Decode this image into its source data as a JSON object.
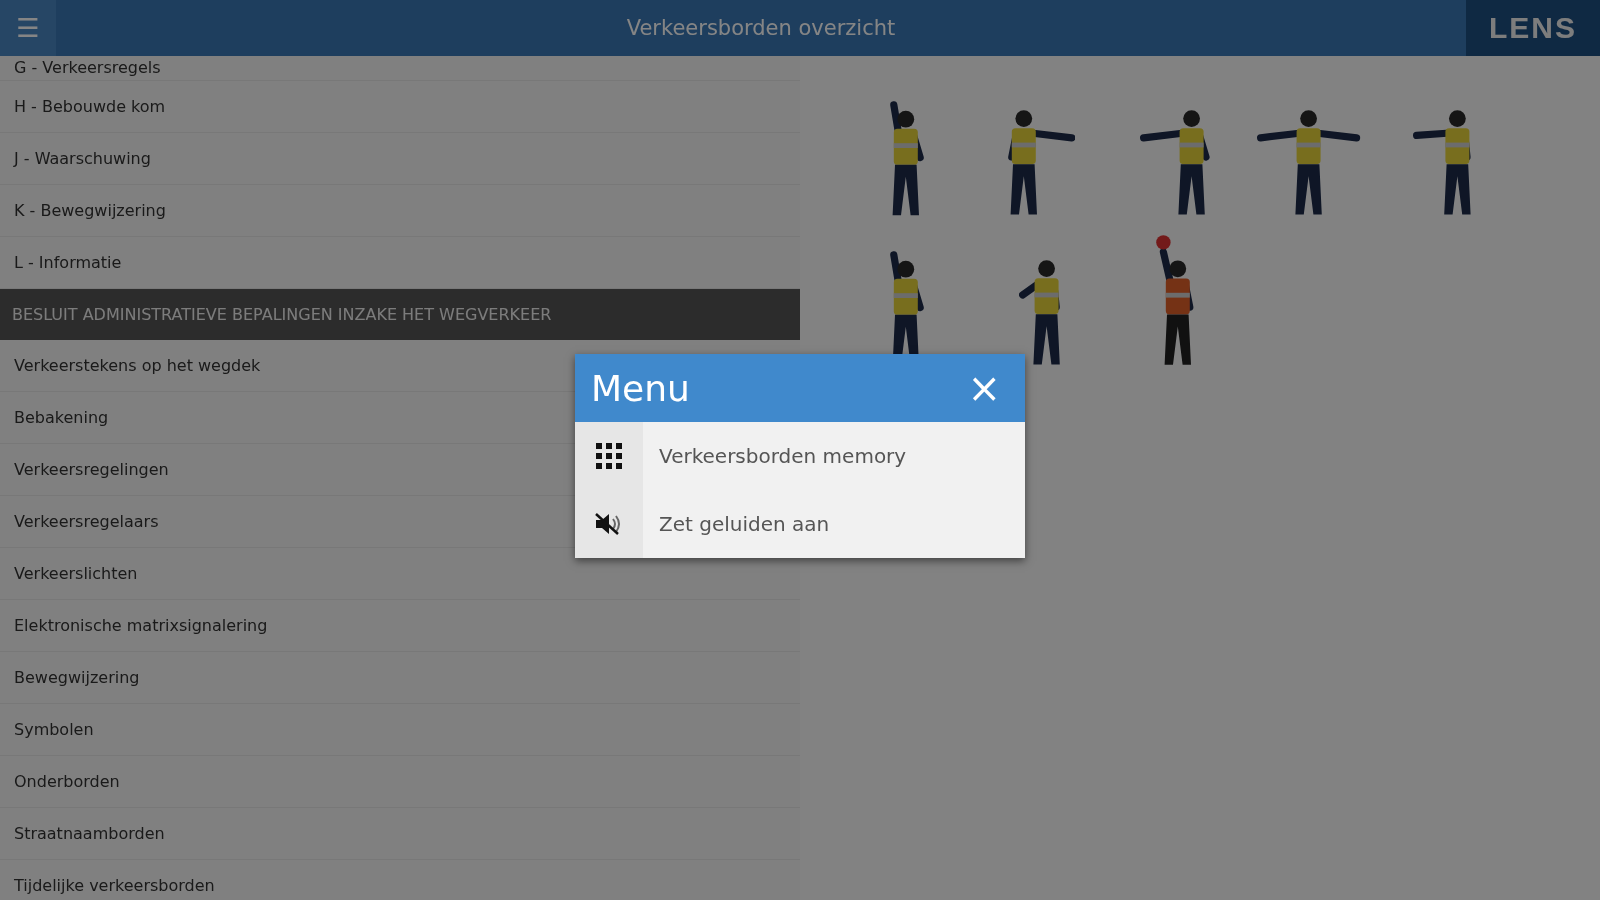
{
  "header": {
    "menu_icon": "☰",
    "title": "Verkeersborden overzicht",
    "logo": "LENS"
  },
  "sidebar": {
    "items": [
      {
        "kind": "item",
        "label": "G - Verkeersregels"
      },
      {
        "kind": "item",
        "label": "H - Bebouwde kom"
      },
      {
        "kind": "item",
        "label": "J - Waarschuwing"
      },
      {
        "kind": "item",
        "label": "K - Bewegwijzering"
      },
      {
        "kind": "item",
        "label": "L - Informatie"
      },
      {
        "kind": "section",
        "label": "BESLUIT ADMINISTRATIEVE BEPALINGEN INZAKE HET WEGVERKEER"
      },
      {
        "kind": "item",
        "label": "Verkeerstekens op het wegdek"
      },
      {
        "kind": "item",
        "label": "Bebakening"
      },
      {
        "kind": "item",
        "label": "Verkeersregelingen"
      },
      {
        "kind": "item",
        "label": "Verkeersregelaars"
      },
      {
        "kind": "item",
        "label": "Verkeerslichten"
      },
      {
        "kind": "item",
        "label": "Elektronische matrixsignalering"
      },
      {
        "kind": "item",
        "label": "Bewegwijzering"
      },
      {
        "kind": "item",
        "label": "Symbolen"
      },
      {
        "kind": "item",
        "label": "Onderborden"
      },
      {
        "kind": "item",
        "label": "Straatnaamborden"
      },
      {
        "kind": "item",
        "label": "Tijdelijke verkeersborden"
      }
    ]
  },
  "signs": [
    {
      "kind": "officer"
    },
    {
      "kind": "officer"
    },
    {
      "kind": "officer"
    },
    {
      "kind": "officer"
    },
    {
      "kind": "officer"
    },
    {
      "kind": "officer"
    },
    {
      "kind": "officer"
    },
    {
      "kind": "flagger"
    }
  ],
  "menu_dialog": {
    "title": "Menu",
    "close": "×",
    "items": [
      {
        "kind": "grid",
        "label": "Verkeersborden memory"
      },
      {
        "kind": "mute",
        "label": "Zet geluiden aan"
      }
    ]
  }
}
